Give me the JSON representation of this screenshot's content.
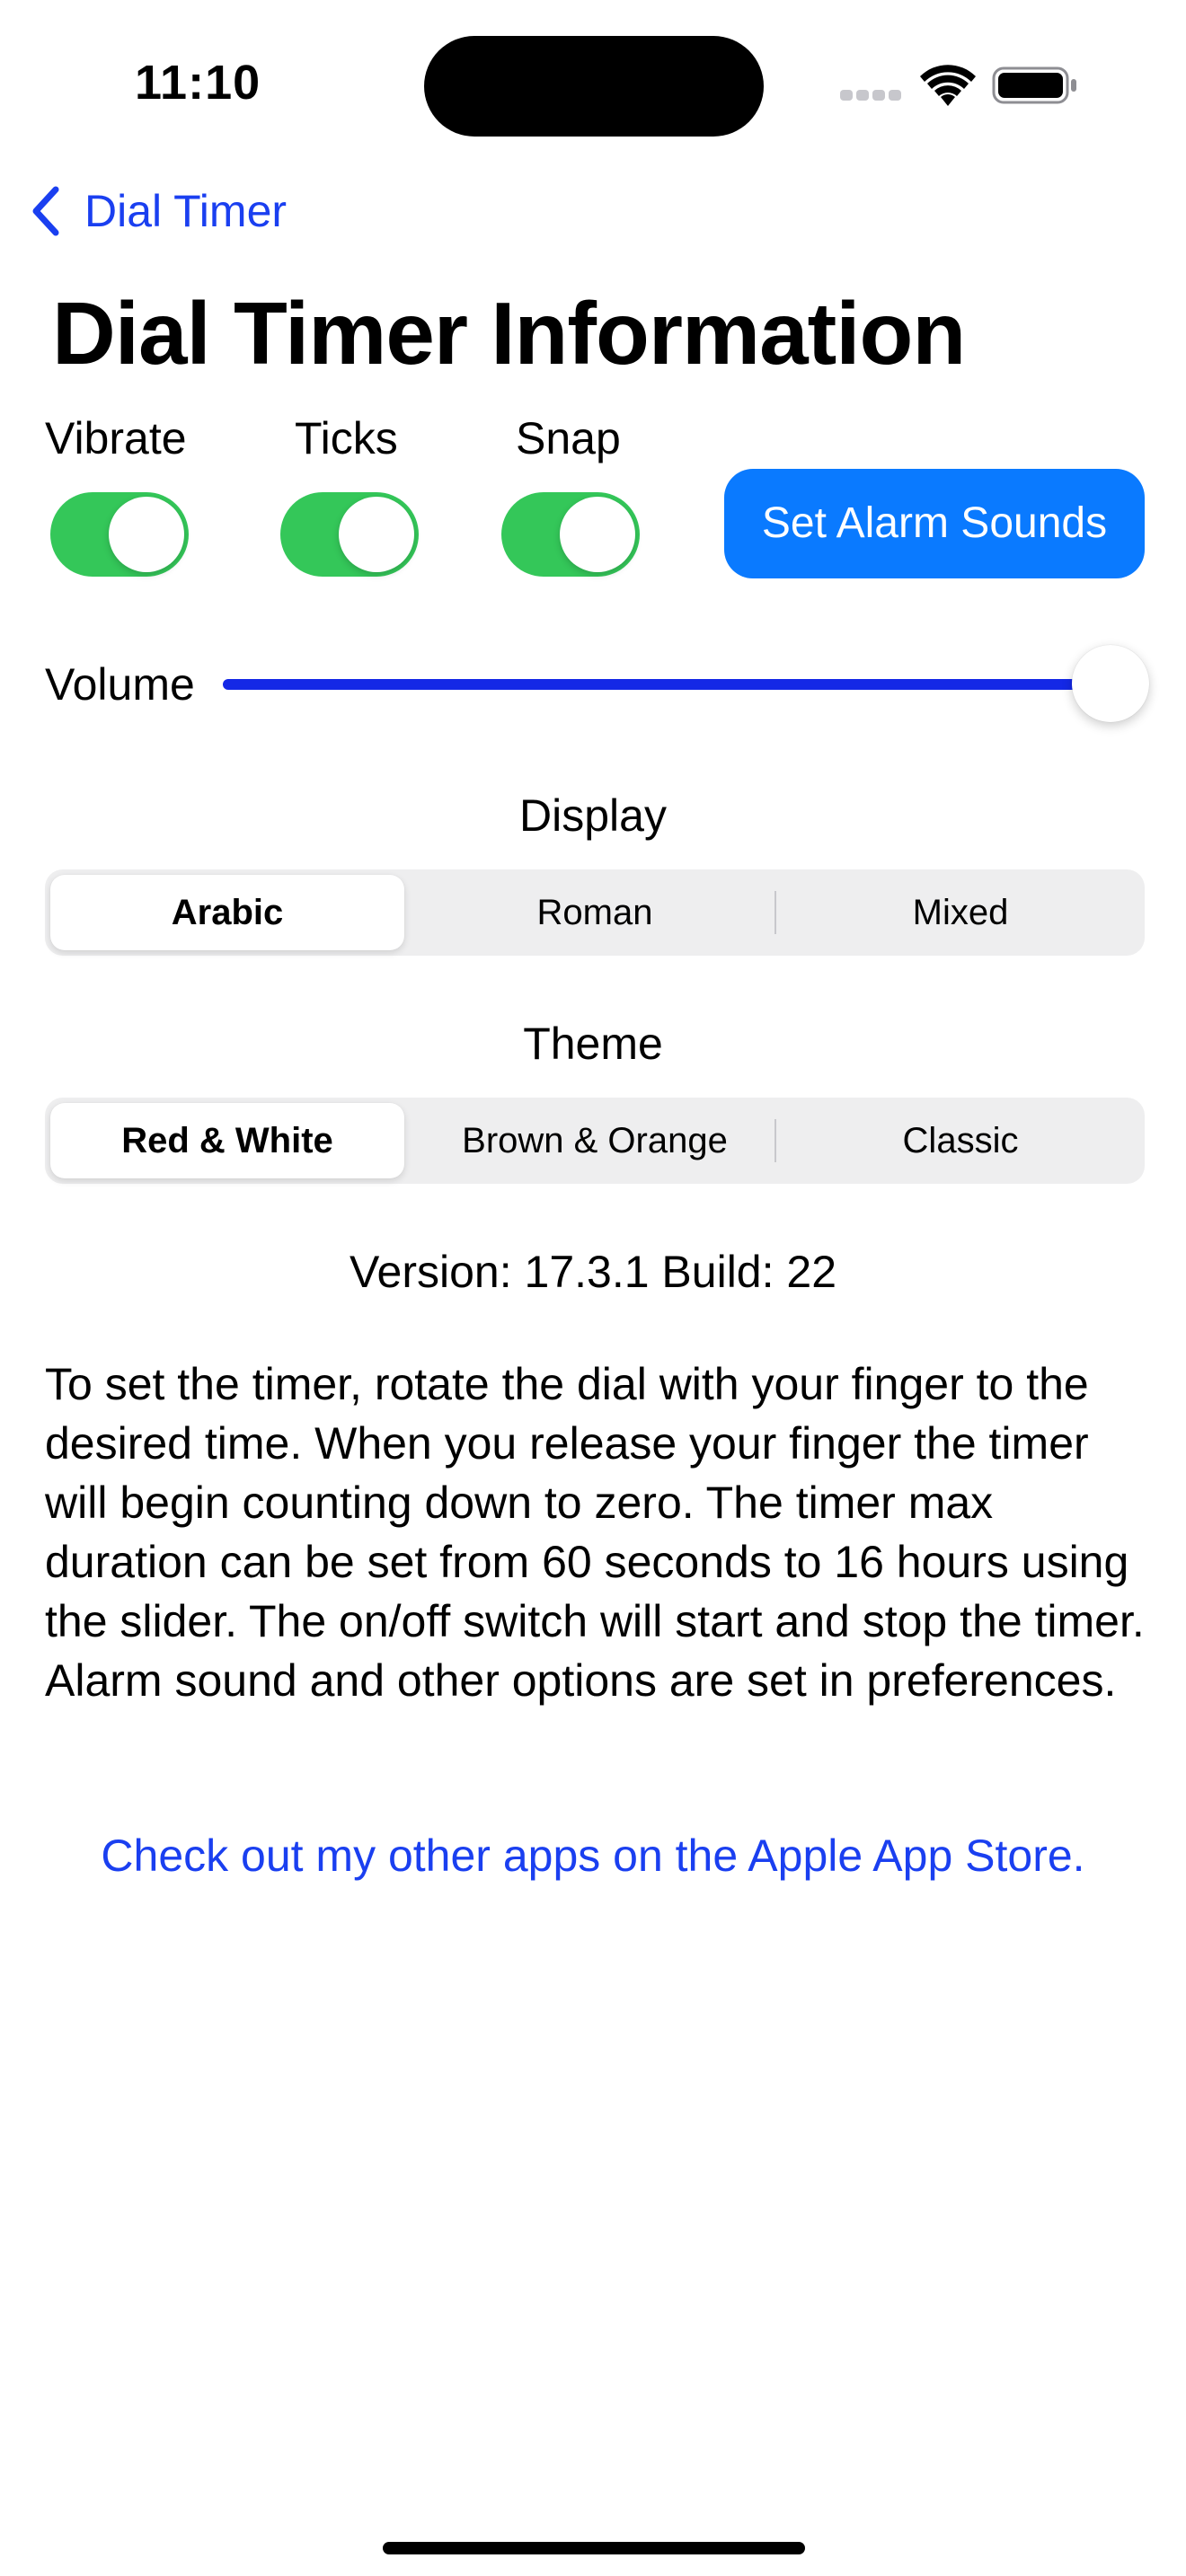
{
  "status_bar": {
    "time": "11:10"
  },
  "nav": {
    "back_label": "Dial Timer"
  },
  "page_title": "Dial Timer Information",
  "toggles": [
    {
      "label": "Vibrate",
      "on": true
    },
    {
      "label": "Ticks",
      "on": true
    },
    {
      "label": "Snap",
      "on": true
    }
  ],
  "alarm_button_label": "Set Alarm Sounds",
  "volume": {
    "label": "Volume",
    "level": 1.0
  },
  "display": {
    "title": "Display",
    "options": [
      "Arabic",
      "Roman",
      "Mixed"
    ],
    "selected": "Arabic"
  },
  "theme": {
    "title": "Theme",
    "options": [
      "Red & White",
      "Brown & Orange",
      "Classic"
    ],
    "selected": "Red & White"
  },
  "version_text": "Version: 17.3.1 Build: 22",
  "description": "To set the timer, rotate the dial with your finger to the desired time.  When you release your finger the timer will begin counting down to zero.  The timer max duration can be set from 60 seconds to 16 hours using the slider.  The on/off switch will start and stop the timer.  Alarm sound and other options are set in preferences.",
  "store_link": "Check out my other apps on the Apple App Store.",
  "colors": {
    "accent": "#1a3ff0",
    "button": "#0a7aff",
    "switch_on": "#34c759",
    "slider": "#1428e6"
  },
  "icons": {
    "back": "chevron-left-icon",
    "wifi": "wifi-icon",
    "battery": "battery-icon",
    "signal": "cellular-signal-icon"
  }
}
